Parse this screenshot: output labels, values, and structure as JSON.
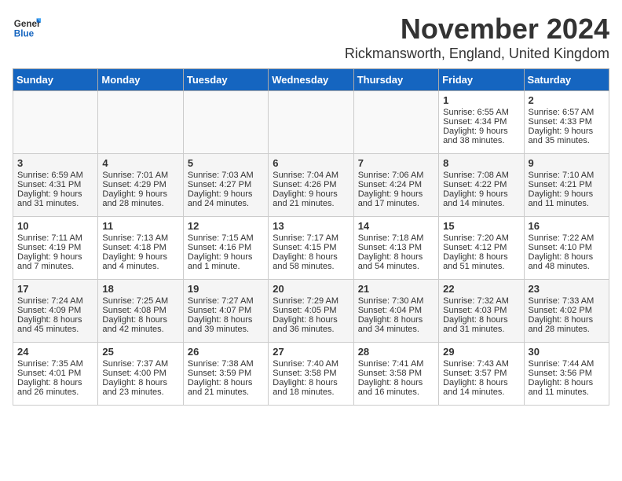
{
  "header": {
    "logo_line1": "General",
    "logo_line2": "Blue",
    "month": "November 2024",
    "location": "Rickmansworth, England, United Kingdom"
  },
  "days_of_week": [
    "Sunday",
    "Monday",
    "Tuesday",
    "Wednesday",
    "Thursday",
    "Friday",
    "Saturday"
  ],
  "weeks": [
    [
      {
        "day": "",
        "content": ""
      },
      {
        "day": "",
        "content": ""
      },
      {
        "day": "",
        "content": ""
      },
      {
        "day": "",
        "content": ""
      },
      {
        "day": "",
        "content": ""
      },
      {
        "day": "1",
        "content": "Sunrise: 6:55 AM\nSunset: 4:34 PM\nDaylight: 9 hours and 38 minutes."
      },
      {
        "day": "2",
        "content": "Sunrise: 6:57 AM\nSunset: 4:33 PM\nDaylight: 9 hours and 35 minutes."
      }
    ],
    [
      {
        "day": "3",
        "content": "Sunrise: 6:59 AM\nSunset: 4:31 PM\nDaylight: 9 hours and 31 minutes."
      },
      {
        "day": "4",
        "content": "Sunrise: 7:01 AM\nSunset: 4:29 PM\nDaylight: 9 hours and 28 minutes."
      },
      {
        "day": "5",
        "content": "Sunrise: 7:03 AM\nSunset: 4:27 PM\nDaylight: 9 hours and 24 minutes."
      },
      {
        "day": "6",
        "content": "Sunrise: 7:04 AM\nSunset: 4:26 PM\nDaylight: 9 hours and 21 minutes."
      },
      {
        "day": "7",
        "content": "Sunrise: 7:06 AM\nSunset: 4:24 PM\nDaylight: 9 hours and 17 minutes."
      },
      {
        "day": "8",
        "content": "Sunrise: 7:08 AM\nSunset: 4:22 PM\nDaylight: 9 hours and 14 minutes."
      },
      {
        "day": "9",
        "content": "Sunrise: 7:10 AM\nSunset: 4:21 PM\nDaylight: 9 hours and 11 minutes."
      }
    ],
    [
      {
        "day": "10",
        "content": "Sunrise: 7:11 AM\nSunset: 4:19 PM\nDaylight: 9 hours and 7 minutes."
      },
      {
        "day": "11",
        "content": "Sunrise: 7:13 AM\nSunset: 4:18 PM\nDaylight: 9 hours and 4 minutes."
      },
      {
        "day": "12",
        "content": "Sunrise: 7:15 AM\nSunset: 4:16 PM\nDaylight: 9 hours and 1 minute."
      },
      {
        "day": "13",
        "content": "Sunrise: 7:17 AM\nSunset: 4:15 PM\nDaylight: 8 hours and 58 minutes."
      },
      {
        "day": "14",
        "content": "Sunrise: 7:18 AM\nSunset: 4:13 PM\nDaylight: 8 hours and 54 minutes."
      },
      {
        "day": "15",
        "content": "Sunrise: 7:20 AM\nSunset: 4:12 PM\nDaylight: 8 hours and 51 minutes."
      },
      {
        "day": "16",
        "content": "Sunrise: 7:22 AM\nSunset: 4:10 PM\nDaylight: 8 hours and 48 minutes."
      }
    ],
    [
      {
        "day": "17",
        "content": "Sunrise: 7:24 AM\nSunset: 4:09 PM\nDaylight: 8 hours and 45 minutes."
      },
      {
        "day": "18",
        "content": "Sunrise: 7:25 AM\nSunset: 4:08 PM\nDaylight: 8 hours and 42 minutes."
      },
      {
        "day": "19",
        "content": "Sunrise: 7:27 AM\nSunset: 4:07 PM\nDaylight: 8 hours and 39 minutes."
      },
      {
        "day": "20",
        "content": "Sunrise: 7:29 AM\nSunset: 4:05 PM\nDaylight: 8 hours and 36 minutes."
      },
      {
        "day": "21",
        "content": "Sunrise: 7:30 AM\nSunset: 4:04 PM\nDaylight: 8 hours and 34 minutes."
      },
      {
        "day": "22",
        "content": "Sunrise: 7:32 AM\nSunset: 4:03 PM\nDaylight: 8 hours and 31 minutes."
      },
      {
        "day": "23",
        "content": "Sunrise: 7:33 AM\nSunset: 4:02 PM\nDaylight: 8 hours and 28 minutes."
      }
    ],
    [
      {
        "day": "24",
        "content": "Sunrise: 7:35 AM\nSunset: 4:01 PM\nDaylight: 8 hours and 26 minutes."
      },
      {
        "day": "25",
        "content": "Sunrise: 7:37 AM\nSunset: 4:00 PM\nDaylight: 8 hours and 23 minutes."
      },
      {
        "day": "26",
        "content": "Sunrise: 7:38 AM\nSunset: 3:59 PM\nDaylight: 8 hours and 21 minutes."
      },
      {
        "day": "27",
        "content": "Sunrise: 7:40 AM\nSunset: 3:58 PM\nDaylight: 8 hours and 18 minutes."
      },
      {
        "day": "28",
        "content": "Sunrise: 7:41 AM\nSunset: 3:58 PM\nDaylight: 8 hours and 16 minutes."
      },
      {
        "day": "29",
        "content": "Sunrise: 7:43 AM\nSunset: 3:57 PM\nDaylight: 8 hours and 14 minutes."
      },
      {
        "day": "30",
        "content": "Sunrise: 7:44 AM\nSunset: 3:56 PM\nDaylight: 8 hours and 11 minutes."
      }
    ]
  ]
}
